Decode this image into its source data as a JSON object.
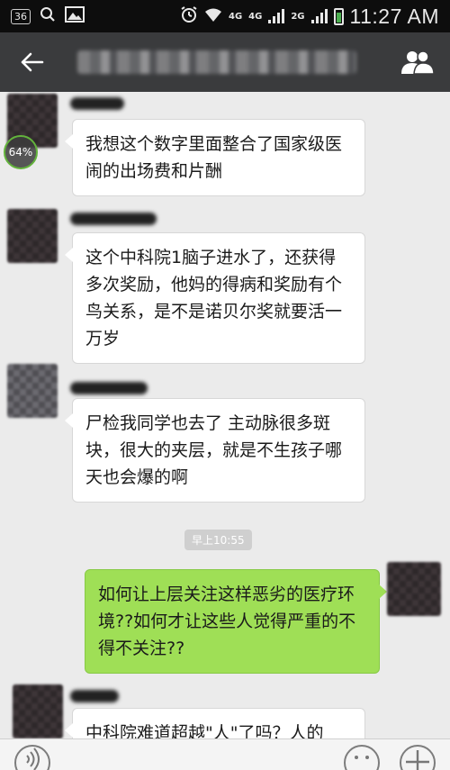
{
  "status_bar": {
    "notification_count": "36",
    "network_1": "4G",
    "network_2": "4G",
    "network_3": "2G",
    "time": "11:27 AM"
  },
  "header": {
    "title": "",
    "back_icon": "back-arrow-icon",
    "contacts_icon": "group-members-icon"
  },
  "download_progress": "64%",
  "messages": [
    {
      "side": "left",
      "text": "我想这个数字里面整合了国家级医闹的出场费和片酬"
    },
    {
      "side": "left",
      "text": "这个中科院1脑子进水了，还获得多次奖励，他妈的得病和奖励有个鸟关系，是不是诺贝尔奖就要活一万岁"
    },
    {
      "side": "left",
      "text": "尸检我同学也去了 主动脉很多斑块，很大的夹层，就是不生孩子哪天也会爆的啊"
    },
    {
      "side": "right",
      "text": "如何让上层关注这样恶劣的医疗环境??如何才让这些人觉得严重的不得不关注??"
    },
    {
      "side": "left",
      "text": "中科院难道超越\"人\"了吗？人的"
    }
  ],
  "timestamp": "早上10:55",
  "colors": {
    "header_bg": "#3a3b3d",
    "chat_bg": "#ebebeb",
    "my_bubble": "#9fdf56",
    "other_bubble": "#ffffff"
  },
  "input_bar": {
    "voice_icon": "voice-icon",
    "emoji_icon": "emoji-icon",
    "add_icon": "plus-icon"
  }
}
